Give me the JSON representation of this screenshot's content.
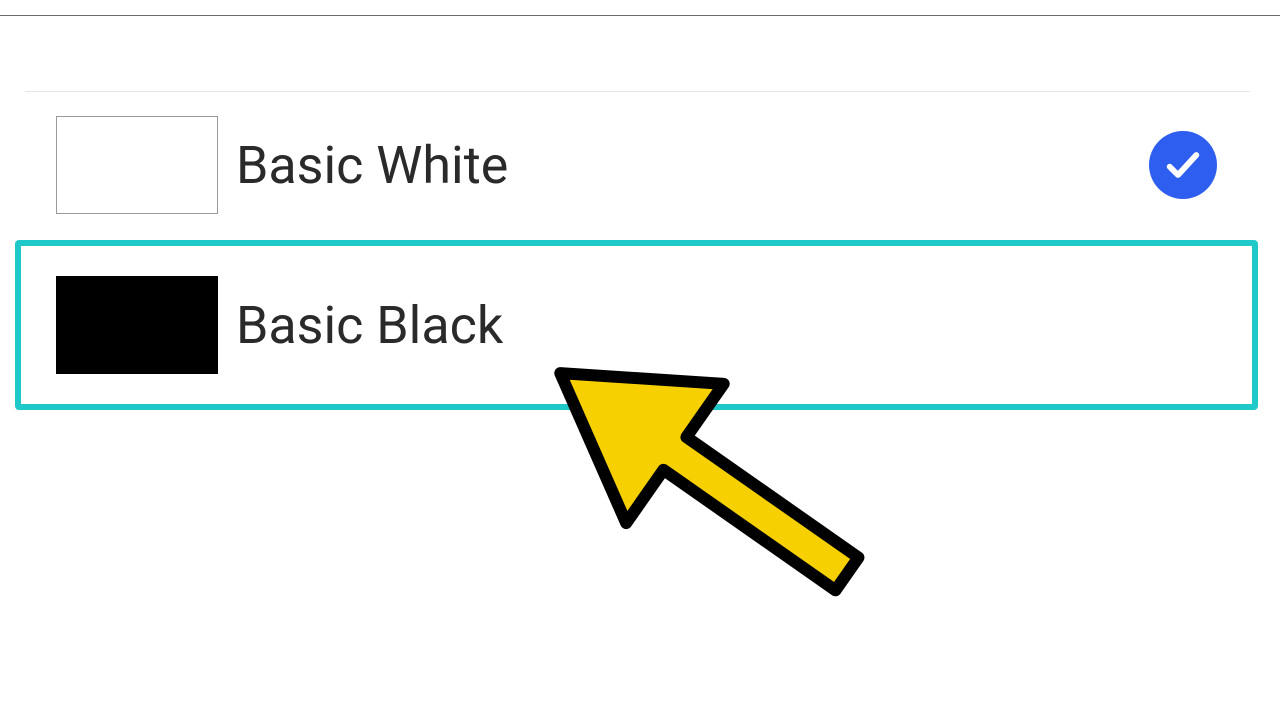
{
  "options": [
    {
      "label": "Basic White",
      "swatch_color": "#ffffff",
      "selected": true
    },
    {
      "label": "Basic Black",
      "swatch_color": "#000000",
      "selected": false
    }
  ],
  "colors": {
    "highlight_border": "#1fc9c9",
    "check_badge": "#2e5ef0",
    "arrow_fill": "#f6d000",
    "arrow_stroke": "#000000"
  }
}
